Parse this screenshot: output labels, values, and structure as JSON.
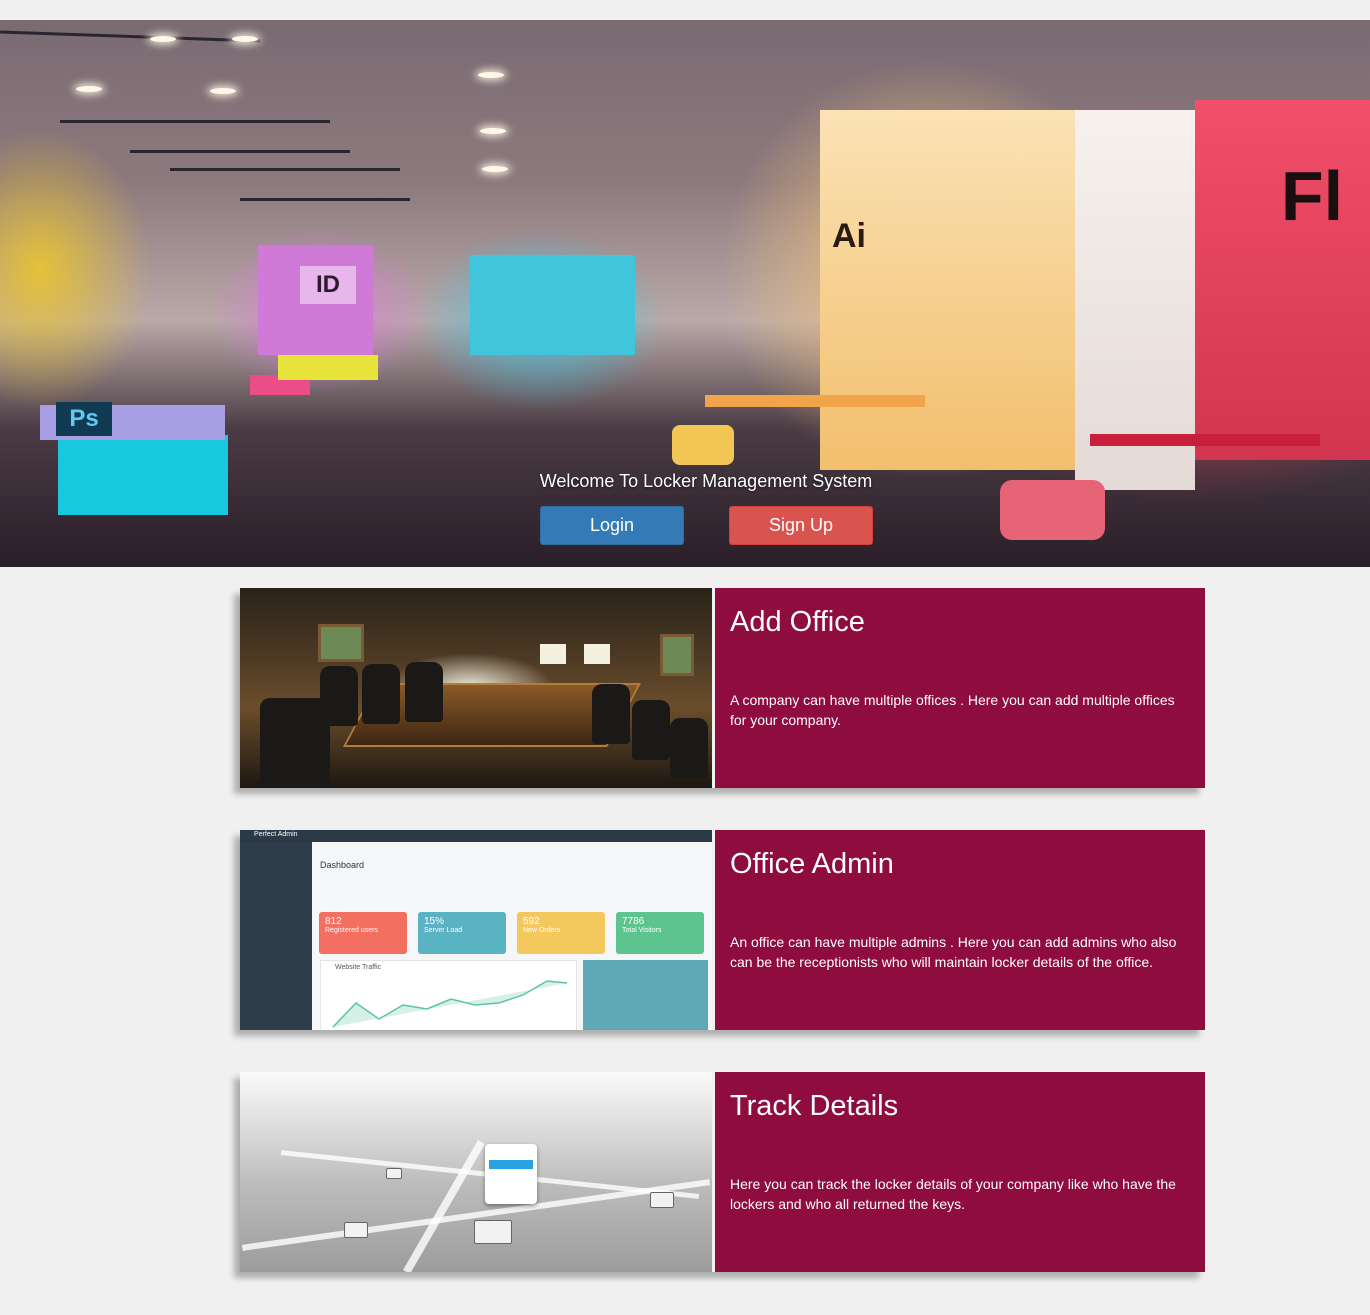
{
  "hero": {
    "title": "Welcome To Locker Management System",
    "login_label": "Login",
    "signup_label": "Sign Up",
    "colors": {
      "login": "#337ab7",
      "signup": "#d9534f"
    },
    "wall_logos": [
      "Ps",
      "ID",
      "Ai",
      "Fl"
    ]
  },
  "cards": [
    {
      "title": "Add Office",
      "description": "A company can have multiple offices . Here you can add multiple offices for your company."
    },
    {
      "title": "Office Admin",
      "description": "An office can have multiple admins . Here you can add admins who also can be the receptionists who will maintain locker details of the office."
    },
    {
      "title": "Track Details",
      "description": "Here you can track the locker details of your company like who have the lockers and who all returned the keys."
    }
  ],
  "dashboard_preview": {
    "brand": "Perfect Admin",
    "heading": "Dashboard",
    "tiles": [
      {
        "value": "812",
        "label": "Registered users",
        "color": "#f36f62"
      },
      {
        "value": "15%",
        "label": "Server Load",
        "color": "#5ab3c2"
      },
      {
        "value": "592",
        "label": "New Orders",
        "color": "#f3c95e"
      },
      {
        "value": "7786",
        "label": "Total Visitors",
        "color": "#5dc490"
      }
    ],
    "chart_title": "Website Traffic"
  },
  "theme": {
    "card_color": "#8e0c3e",
    "background": "#f0f0f0"
  }
}
